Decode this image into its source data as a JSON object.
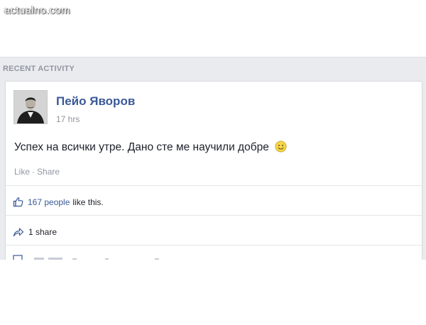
{
  "watermark": "actualno.com",
  "panel": {
    "header": "RECENT ACTIVITY"
  },
  "post": {
    "author": "Пейо Яворов",
    "time": "17 hrs",
    "text": "Успех на всички утре. Дано сте ме научили добре",
    "emoji": "smiley-icon",
    "actions": {
      "like": "Like",
      "separator": "·",
      "share": "Share"
    },
    "likes": {
      "count_label": "167 people",
      "suffix": "like this."
    },
    "shares": {
      "label": "1 share"
    }
  },
  "colors": {
    "link": "#3b5998",
    "muted": "#9197a3",
    "panel_bg": "#e9ebee"
  }
}
